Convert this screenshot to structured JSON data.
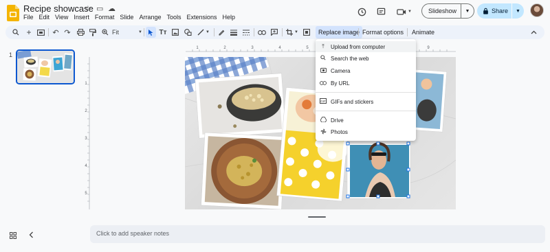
{
  "document": {
    "title": "Recipe showcase"
  },
  "menu": [
    "File",
    "Edit",
    "View",
    "Insert",
    "Format",
    "Slide",
    "Arrange",
    "Tools",
    "Extensions",
    "Help"
  ],
  "header": {
    "slideshow_label": "Slideshow",
    "share_label": "Share"
  },
  "toolbar": {
    "zoom_label": "Fit",
    "replace_image_label": "Replace image",
    "format_options_label": "Format options",
    "animate_label": "Animate"
  },
  "filmstrip": {
    "slide_number": "1"
  },
  "replace_menu": {
    "items": [
      {
        "label": "Upload from computer",
        "icon": "upload-icon"
      },
      {
        "label": "Search the web",
        "icon": "search-icon"
      },
      {
        "label": "Camera",
        "icon": "camera-icon"
      },
      {
        "label": "By URL",
        "icon": "link-icon"
      },
      {
        "label": "GIFs and stickers",
        "icon": "gif-icon"
      },
      {
        "label": "Drive",
        "icon": "drive-icon"
      },
      {
        "label": "Photos",
        "icon": "photos-icon"
      }
    ]
  },
  "notes": {
    "placeholder": "Click to add speaker notes"
  },
  "colors": {
    "accent": "#0b57d0",
    "share_bg": "#c2e7ff",
    "toolbar_bg": "#edf2fa",
    "slides_yellow": "#f4b400"
  }
}
